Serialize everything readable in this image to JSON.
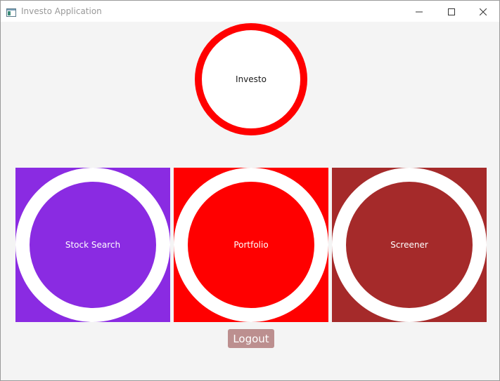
{
  "window": {
    "title": "Investo Application",
    "icons": {
      "app": "app-window-icon",
      "minimize": "minimize-icon",
      "maximize": "maximize-icon",
      "close": "close-icon"
    }
  },
  "logo": {
    "label": "Investo",
    "ring_color": "#ff0000"
  },
  "tiles": [
    {
      "label": "Stock Search",
      "color": "#8a2be2"
    },
    {
      "label": "Portfolio",
      "color": "#ff0000"
    },
    {
      "label": "Screener",
      "color": "#a52a2a"
    }
  ],
  "logout": {
    "label": "Logout",
    "color": "#bc8f8f"
  }
}
